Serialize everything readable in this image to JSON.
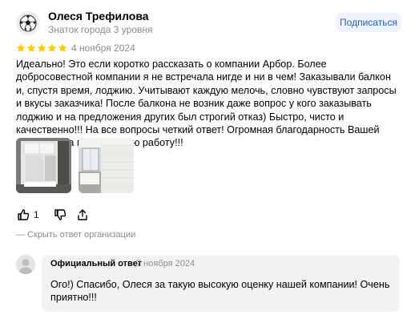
{
  "author": {
    "name": "Олеся Трефилова",
    "level": "Знаток города 3 уровня",
    "avatar_icon": "soccer-ball-icon"
  },
  "subscribe_label": "Подписаться",
  "review": {
    "rating": 5,
    "rating_max": 5,
    "date": "4 ноября 2024",
    "text": "Идеально! Это если коротко рассказать о компании Арбор. Более добросовестной компании я не встречала нигде и ни в чем! Заказывали балкон и, спустя время, лоджию. Учитывают каждую мелочь, словно чувствуют запросы и вкусы заказчика! После балкона не возник даже вопрос у кого заказывать лоджию и на предложения других был строгий отказ) Быстро, чисто и качественно!!! На все вопросы четкий ответ! Огромная благодарность Вашей компании за проделанную работу!!!",
    "photos": [
      "balcony-photo-1",
      "balcony-photo-2"
    ]
  },
  "actions": {
    "like_count": "1",
    "like_icon": "thumbs-up-icon",
    "dislike_icon": "thumbs-down-icon",
    "share_icon": "share-icon"
  },
  "hide_answer_label": "— Скрыть ответ организации",
  "official_answer": {
    "label": "Официальный ответ",
    "date": "7 ноября 2024",
    "text": "Ого!) Спасибо, Олеся за такую высокую оценку нашей компании! Очень приятно!!!"
  },
  "colors": {
    "star": "#fc0",
    "accent": "#2d5bd1",
    "muted": "#8c8c8c",
    "answer_bg": "#f2f2f2"
  }
}
